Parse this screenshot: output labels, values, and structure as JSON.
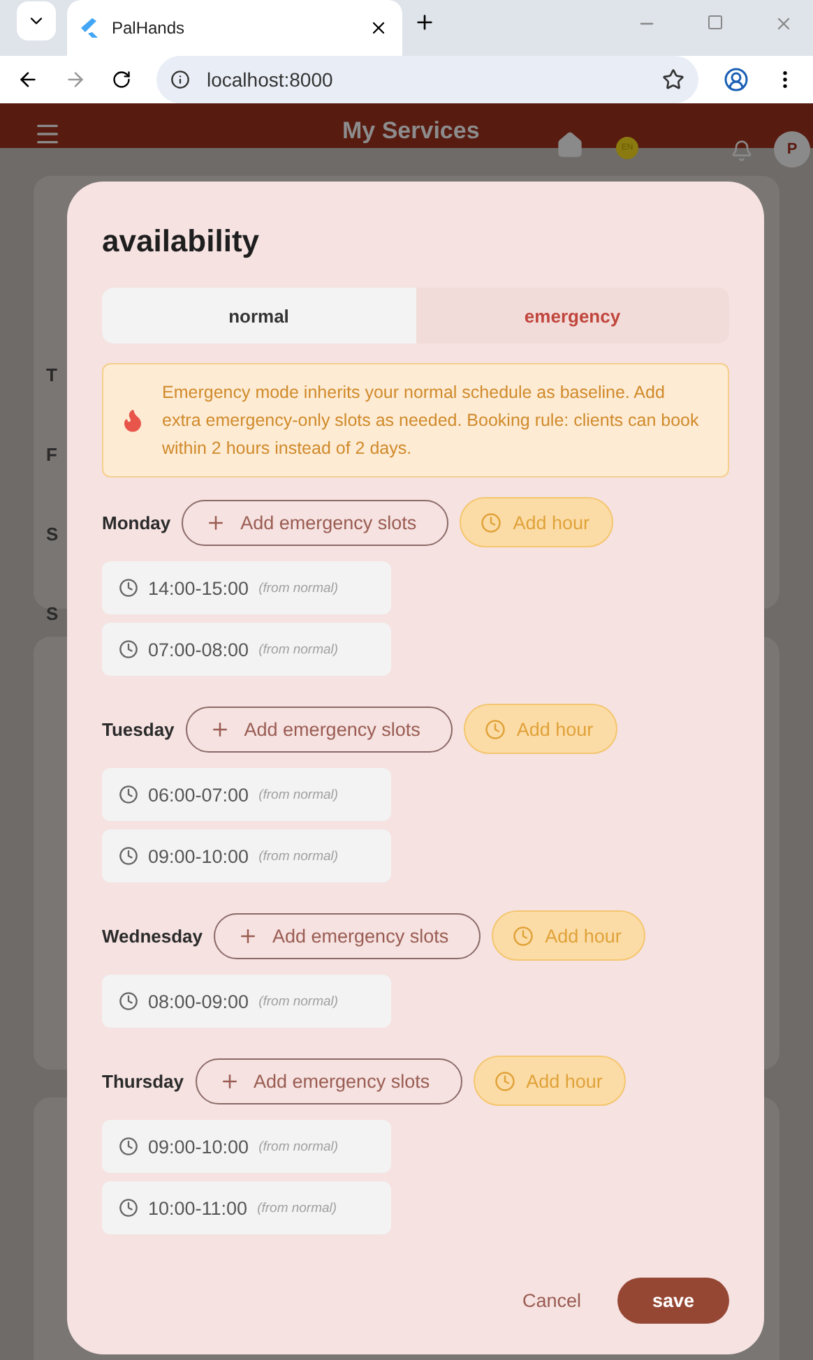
{
  "browser": {
    "tab_title": "PalHands",
    "url": "localhost:8000"
  },
  "app_header": {
    "title": "My Services",
    "language_badge": "EN",
    "avatar_initial": "P"
  },
  "background_labels": [
    "T",
    "F",
    "S",
    "S"
  ],
  "dialog": {
    "title": "availability",
    "tabs": [
      {
        "label": "normal",
        "selected": false
      },
      {
        "label": "emergency",
        "selected": true
      }
    ],
    "notice": "Emergency mode inherits your normal schedule as baseline. Add extra emergency-only slots as needed. Booking rule: clients can book within 2 hours instead of 2 days.",
    "days": [
      {
        "name": "Monday",
        "add_slots_label": "Add emergency slots",
        "add_hour_label": "Add hour",
        "slots": [
          {
            "time": "14:00-15:00",
            "note": "(from normal)"
          },
          {
            "time": "07:00-08:00",
            "note": "(from normal)"
          }
        ]
      },
      {
        "name": "Tuesday",
        "add_slots_label": "Add emergency slots",
        "add_hour_label": "Add hour",
        "slots": [
          {
            "time": "06:00-07:00",
            "note": "(from normal)"
          },
          {
            "time": "09:00-10:00",
            "note": "(from normal)"
          }
        ]
      },
      {
        "name": "Wednesday",
        "add_slots_label": "Add emergency slots",
        "add_hour_label": "Add hour",
        "slots": [
          {
            "time": "08:00-09:00",
            "note": "(from normal)"
          }
        ]
      },
      {
        "name": "Thursday",
        "add_slots_label": "Add emergency slots",
        "add_hour_label": "Add hour",
        "slots": [
          {
            "time": "09:00-10:00",
            "note": "(from normal)"
          },
          {
            "time": "10:00-11:00",
            "note": "(from normal)"
          }
        ]
      }
    ],
    "cancel_label": "Cancel",
    "save_label": "save"
  }
}
